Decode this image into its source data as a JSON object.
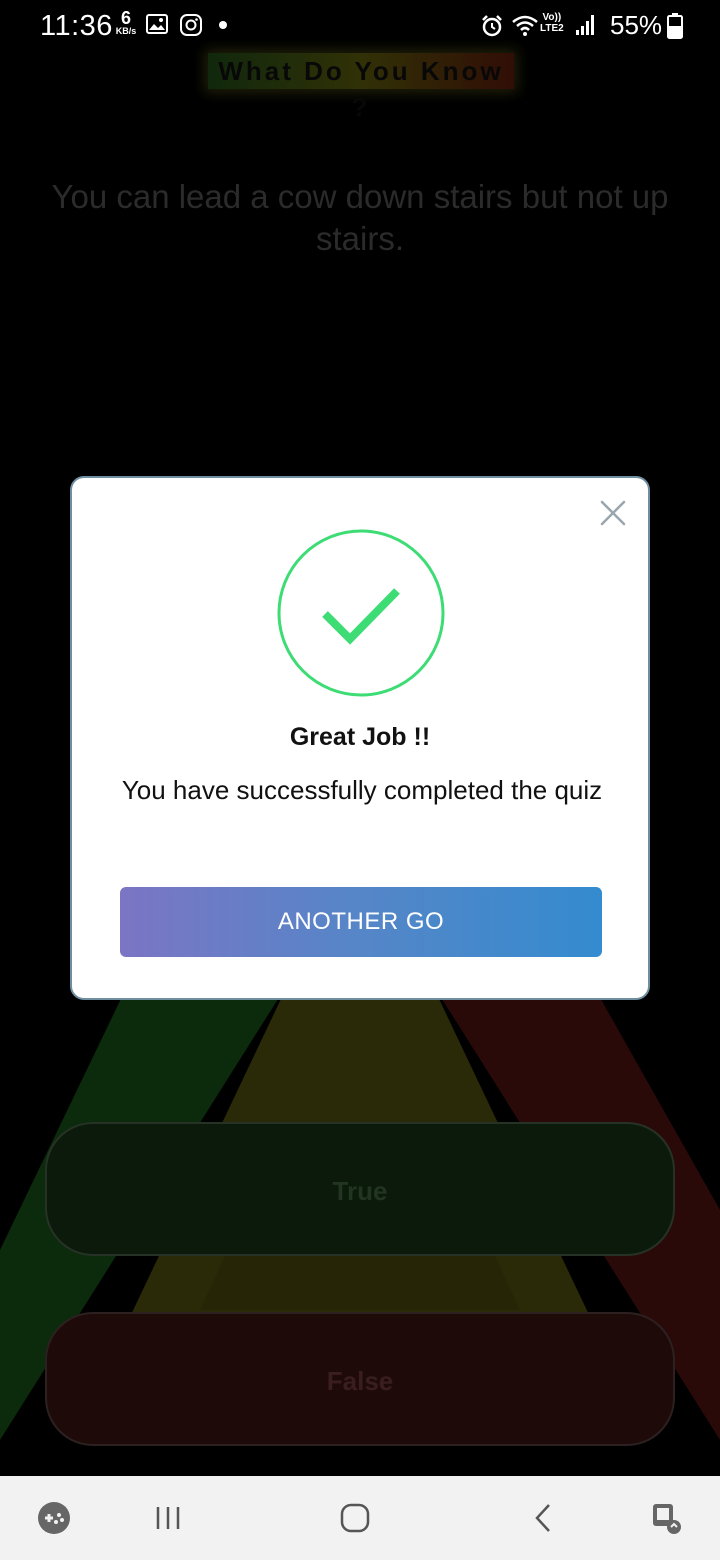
{
  "status_bar": {
    "time": "11:36",
    "data_speed": "6",
    "data_speed_unit": "KB/s",
    "network_label_top": "Vo))",
    "network_label_bottom": "LTE2",
    "battery": "55%"
  },
  "app": {
    "title": "What Do You Know ?",
    "question": "You can lead a cow down stairs but not up stairs.",
    "answers": {
      "true_label": "True",
      "false_label": "False"
    }
  },
  "modal": {
    "heading": "Great Job !!",
    "message": "You have successfully completed the quiz",
    "button_label": "ANOTHER GO",
    "accent_color": "#3ddc74",
    "button_gradient": [
      "#7b75c4",
      "#348bcf"
    ]
  },
  "nav_bar": {
    "icons": [
      "game-launcher-icon",
      "recent-apps-icon",
      "home-icon",
      "back-icon",
      "screen-assist-icon"
    ]
  }
}
